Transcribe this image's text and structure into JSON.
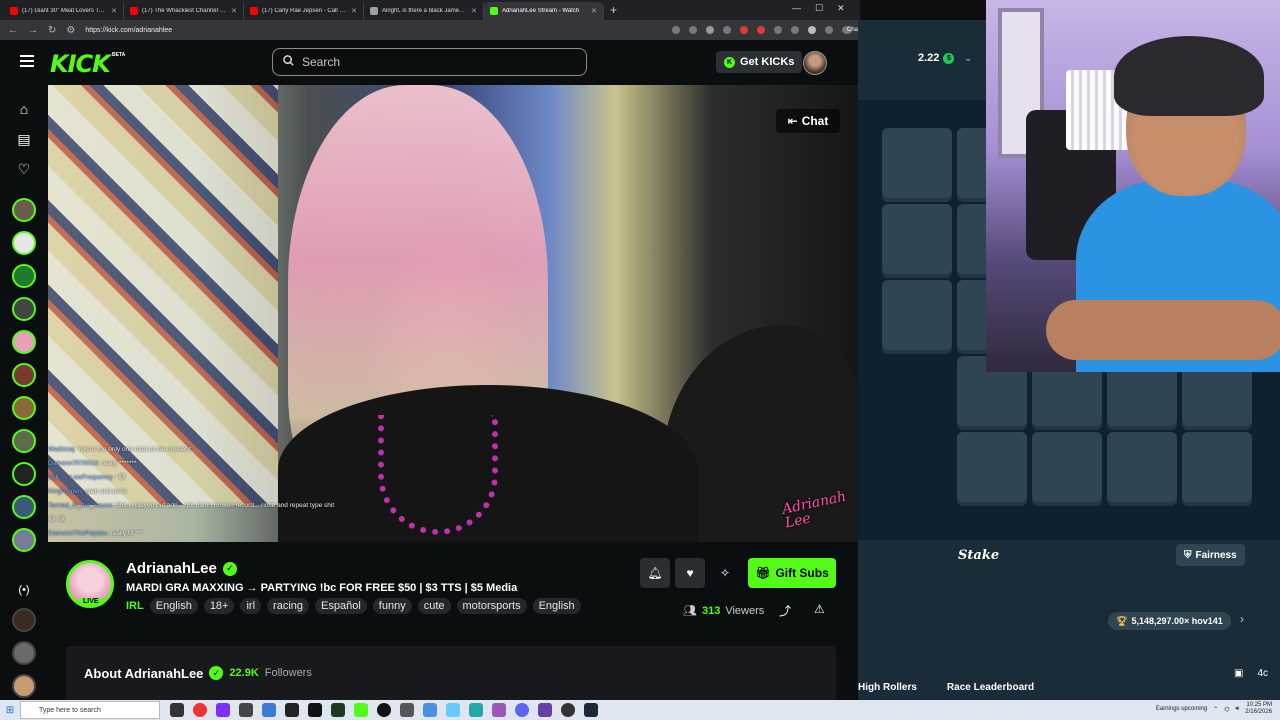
{
  "browser": {
    "tabs": [
      {
        "title": "(17) Giant 30\" Meat Lovers Team P",
        "color": "#ff0000"
      },
      {
        "title": "(17) The Whackiest Channel on Yo",
        "color": "#ff0000"
      },
      {
        "title": "(17) Carly Rae Jepsen - Call Me M",
        "color": "#ff0000"
      },
      {
        "title": "Alright, is there a black James Bon",
        "color": "#9aa0a6"
      },
      {
        "title": "AdrianahLee Stream - Watch",
        "color": "#53fc18"
      }
    ],
    "url": "https://kick.com/adrianahlee",
    "chat_extension": "Chat"
  },
  "header": {
    "logo": "KICK",
    "beta": "BETA",
    "search_placeholder": "Search",
    "get_kicks": "Get KICKs"
  },
  "video": {
    "chat_button": "Chat",
    "overlay_lines": [
      {
        "user": "Wadizzaj:",
        "text": " You're the only one mad at the moment"
      },
      {
        "user": "Damonn7070013:",
        "text": " really *******"
      },
      {
        "user": "ZeK → LowFrequency :",
        "text": " 😂"
      },
      {
        "user": "KingRippen:",
        "text": " grab and push"
      },
      {
        "user": "Terrred_in_the_Sauce:",
        "text": " Shit is played out adri... got damn broken record... rinse and repeat type shit"
      },
      {
        "user": "",
        "text": "😂 😂"
      },
      {
        "user": "DamonnTNoPopdas:",
        "text": " really M ***"
      }
    ],
    "watermark": "Adrianah Lee"
  },
  "stream": {
    "name": "AdrianahLee",
    "live": "LIVE",
    "title": "MARDI GRA MAXXING → PARTYING !bc FOR FREE $50 | $3 TTS | $5 Media",
    "category": "IRL",
    "tags": [
      "English",
      "18+",
      "irl",
      "racing",
      "Español",
      "funny",
      "cute",
      "motorsports",
      "English"
    ],
    "gift_subs": "Gift Subs",
    "viewer_count": "313",
    "viewers_label": "Viewers",
    "about_label": "About AdrianahLee",
    "followers_count": "22.9K",
    "followers_label": "Followers"
  },
  "stake": {
    "balance": "2.22",
    "logo": "Stake",
    "fairness": "Fairness",
    "big_win": "5,148,297.00× hov141",
    "tabs": [
      "High Rollers",
      "Race Leaderboard"
    ],
    "partial": "4c"
  },
  "taskbar": {
    "search_placeholder": "Type here to search",
    "notification": "Earnings upcoming",
    "time": "10:25 PM",
    "date": "2/16/2026"
  }
}
